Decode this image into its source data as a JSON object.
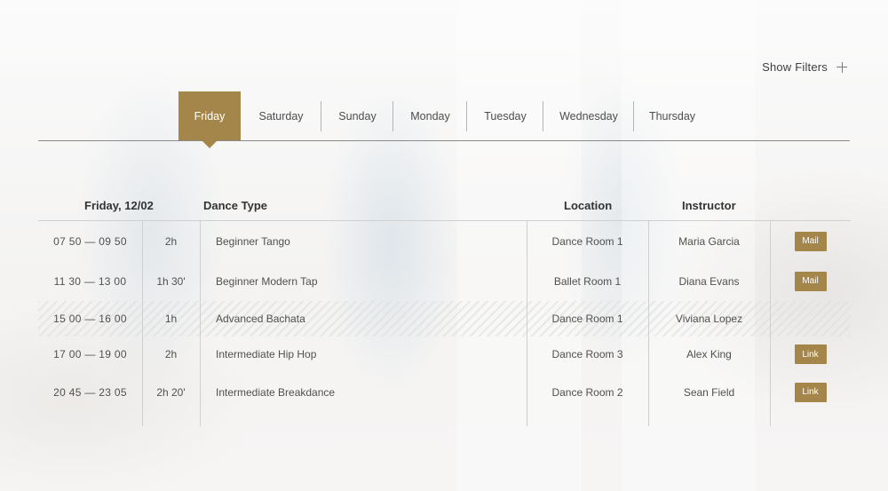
{
  "filters": {
    "label": "Show Filters",
    "icon": "plus-icon"
  },
  "tabs": [
    {
      "label": "Friday",
      "active": true
    },
    {
      "label": "Saturday",
      "active": false
    },
    {
      "label": "Sunday",
      "active": false
    },
    {
      "label": "Monday",
      "active": false
    },
    {
      "label": "Tuesday",
      "active": false
    },
    {
      "label": "Wednesday",
      "active": false
    },
    {
      "label": "Thursday",
      "active": false
    }
  ],
  "table": {
    "headers": {
      "date": "Friday, 12/02",
      "type": "Dance Type",
      "location": "Location",
      "instructor": "Instructor"
    },
    "rows": [
      {
        "time": "07 50 — 09 50",
        "duration": "2h",
        "type": "Beginner Tango",
        "location": "Dance Room 1",
        "instructor": "Maria Garcia",
        "action": "Mail"
      },
      {
        "time": "11 30 — 13 00",
        "duration": "1h 30'",
        "type": "Beginner Modern Tap",
        "location": "Ballet Room 1",
        "instructor": "Diana Evans",
        "action": "Mail"
      },
      {
        "time": "15 00 — 16 00",
        "duration": "1h",
        "type": "Advanced Bachata",
        "location": "Dance Room 1",
        "instructor": "Viviana Lopez",
        "action": ""
      },
      {
        "time": "17 00 — 19 00",
        "duration": "2h",
        "type": "Intermediate Hip Hop",
        "location": "Dance Room 3",
        "instructor": "Alex King",
        "action": "Link"
      },
      {
        "time": "20 45 — 23 05",
        "duration": "2h 20'",
        "type": "Intermediate Breakdance",
        "location": "Dance Room 2",
        "instructor": "Sean Field",
        "action": "Link"
      }
    ]
  },
  "colors": {
    "accent": "#a5864a",
    "text": "#4a4a4a"
  }
}
